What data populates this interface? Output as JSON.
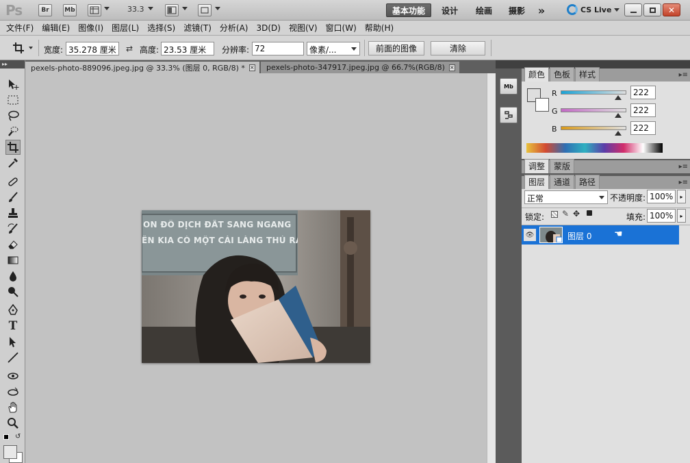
{
  "app": {
    "logo": "Ps",
    "bridge_label": "Br",
    "mini_bridge_label": "Mb",
    "zoom": "33.3",
    "workspaces": [
      "基本功能",
      "设计",
      "绘画",
      "摄影"
    ],
    "overflow_label": "»",
    "cslive_label": "CS Live"
  },
  "menu": [
    "文件(F)",
    "编辑(E)",
    "图像(I)",
    "图层(L)",
    "选择(S)",
    "滤镜(T)",
    "分析(A)",
    "3D(D)",
    "视图(V)",
    "窗口(W)",
    "帮助(H)"
  ],
  "options": {
    "width_label": "宽度:",
    "width_value": "35.278 厘米",
    "height_label": "高度:",
    "height_value": "23.53 厘米",
    "resolution_label": "分辨率:",
    "resolution_value": "72",
    "unit_value": "像素/...",
    "front_image_button": "前面的图像",
    "clear_button": "清除"
  },
  "documents": {
    "active_tab": "pexels-photo-889096.jpeg.jpg @ 33.3% (图层 0, RGB/8) *",
    "inactive_tab": "pexels-photo-347917.jpeg.jpg @ 66.7%(RGB/8)",
    "close_label": "×"
  },
  "photo": {
    "sign_line1": "ON ĐÔ  DỊCH ĐẤT SANG NGANG",
    "sign_line2": "ẾN KIA  CÓ MỘT CÁI LÀNG THỦ RA ..."
  },
  "dock": {
    "mini_bridge": "Mb"
  },
  "color_panel": {
    "tabs": [
      "颜色",
      "色板",
      "样式"
    ],
    "channels": [
      {
        "label": "R",
        "value": "222",
        "fraction": 0.87,
        "gradient": "linear-gradient(90deg,#1aa3d6,#dedede)"
      },
      {
        "label": "G",
        "value": "222",
        "fraction": 0.87,
        "gradient": "linear-gradient(90deg,#c36ac5,#dedede)"
      },
      {
        "label": "B",
        "value": "222",
        "fraction": 0.87,
        "gradient": "linear-gradient(90deg,#d99a1a,#dedede)"
      }
    ]
  },
  "adjust_panel": {
    "tabs": [
      "调整",
      "蒙版"
    ]
  },
  "layers_panel": {
    "tabs": [
      "图层",
      "通道",
      "路径"
    ],
    "blend_mode": "正常",
    "opacity_label": "不透明度:",
    "opacity_value": "100%",
    "lock_label": "锁定:",
    "fill_label": "填充:",
    "fill_value": "100%",
    "layers": [
      {
        "name": "图层 0",
        "selected": true
      }
    ]
  },
  "colors": {
    "selection_blue": "#1a72d6",
    "canvas_gray": "#c2c2c2"
  }
}
